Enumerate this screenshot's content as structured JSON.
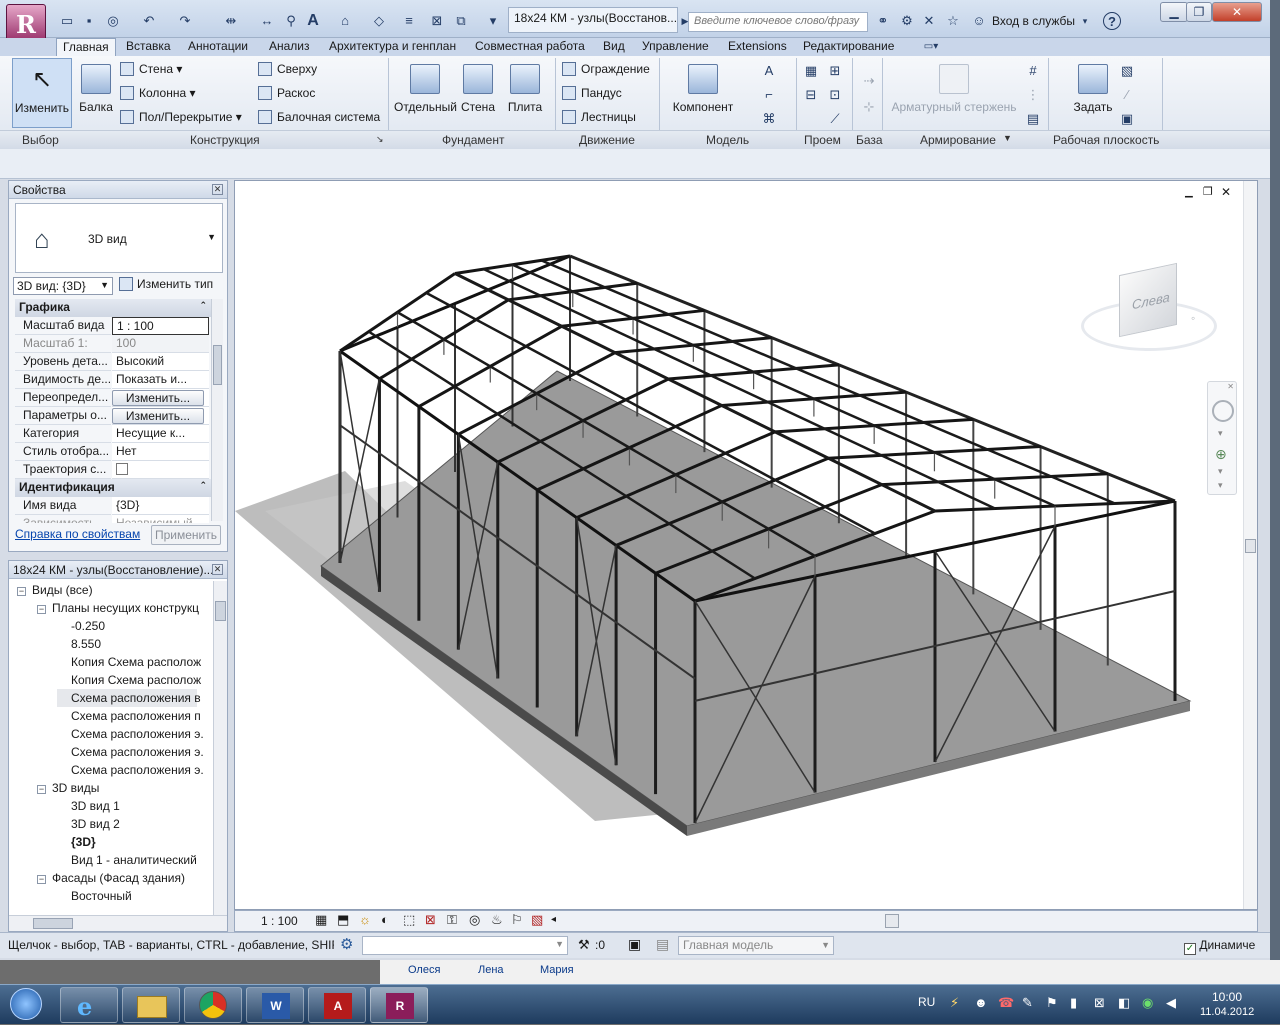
{
  "window": {
    "doc_title": "18х24 КМ - узлы(Восстанов...",
    "search_placeholder": "Введите ключевое слово/фразу",
    "login": "Вход в службы",
    "help": "?"
  },
  "tabs": [
    "Главная",
    "Вставка",
    "Аннотации",
    "Анализ",
    "Архитектура и генплан",
    "Совместная работа",
    "Вид",
    "Управление",
    "Extensions",
    "Редактирование"
  ],
  "ribbon": {
    "modify": "Изменить",
    "beam": "Балка",
    "wall": "Стена",
    "column": "Колонна",
    "floor": "Пол/Перекрытие",
    "top": "Сверху",
    "brace": "Раскос",
    "beam_system": "Балочная система",
    "isolated": "Отдельный",
    "wall_found": "Стена",
    "slab": "Плита",
    "railing": "Ограждение",
    "ramp": "Пандус",
    "stairs": "Лестницы",
    "component": "Компонент",
    "rebar": "Арматурный стержень",
    "set": "Задать",
    "groups": {
      "select": "Выбор",
      "structure": "Конструкция",
      "foundation": "Фундамент",
      "circulation": "Движение",
      "model": "Модель",
      "opening": "Проем",
      "datum": "База",
      "reinforcement": "Армирование",
      "workplane": "Рабочая плоскость"
    }
  },
  "properties": {
    "title": "Свойства",
    "type_name": "3D вид",
    "selector": "3D вид: {3D}",
    "edit_type": "Изменить тип",
    "section_graphics": "Графика",
    "rows": [
      {
        "k": "Масштаб вида",
        "v": "1 : 100"
      },
      {
        "k": "Масштаб    1:",
        "v": "100"
      },
      {
        "k": "Уровень дета...",
        "v": "Высокий"
      },
      {
        "k": "Видимость де...",
        "v": "Показать и..."
      },
      {
        "k": "Переопредел...",
        "v": "Изменить..."
      },
      {
        "k": "Параметры о...",
        "v": "Изменить..."
      },
      {
        "k": "Категория",
        "v": "Несущие к..."
      },
      {
        "k": "Стиль отобра...",
        "v": "Нет"
      },
      {
        "k": "Траектория с...",
        "v": ""
      }
    ],
    "section_ident": "Идентификация",
    "view_name_k": "Имя вида",
    "view_name_v": "{3D}",
    "dep_k": "Зависимость",
    "dep_v": "Независимый",
    "help_link": "Справка по свойствам",
    "apply": "Применить"
  },
  "browser": {
    "title": "18х24 КМ - узлы(Восстановление)...",
    "items": [
      {
        "t": "Виды (все)",
        "lvl": 0,
        "tog": "−"
      },
      {
        "t": "Планы несущих конструкц",
        "lvl": 1,
        "tog": "−"
      },
      {
        "t": "-0.250",
        "lvl": 2
      },
      {
        "t": "8.550",
        "lvl": 2
      },
      {
        "t": "Копия Схема располож",
        "lvl": 2
      },
      {
        "t": "Копия Схема располож",
        "lvl": 2
      },
      {
        "t": "Схема расположения в",
        "lvl": 2,
        "sel": true
      },
      {
        "t": "Схема расположения п",
        "lvl": 2
      },
      {
        "t": "Схема расположения э.",
        "lvl": 2
      },
      {
        "t": "Схема расположения э.",
        "lvl": 2
      },
      {
        "t": "Схема расположения э.",
        "lvl": 2
      },
      {
        "t": "3D виды",
        "lvl": 1,
        "tog": "−"
      },
      {
        "t": "3D вид 1",
        "lvl": 2
      },
      {
        "t": "3D вид 2",
        "lvl": 2
      },
      {
        "t": "{3D}",
        "lvl": 2,
        "bold": true
      },
      {
        "t": "Вид 1 - аналитический",
        "lvl": 2
      },
      {
        "t": "Фасады (Фасад здания)",
        "lvl": 1,
        "tog": "−"
      },
      {
        "t": "Восточный",
        "lvl": 2
      }
    ]
  },
  "viewcube": {
    "face": "Слева"
  },
  "viewctrl": {
    "scale": "1 : 100"
  },
  "status": {
    "hint": "Щелчок - выбор, TAB - варианты, CTRL - добавление, SHIF",
    "count": ":0",
    "model": "Главная модель",
    "dynamic": "Динамиче"
  },
  "behind": {
    "names": [
      "Олеся",
      "Лена",
      "Мария"
    ]
  },
  "taskbar": {
    "lang": "RU",
    "time": "10:00",
    "date": "11.04.2012"
  }
}
